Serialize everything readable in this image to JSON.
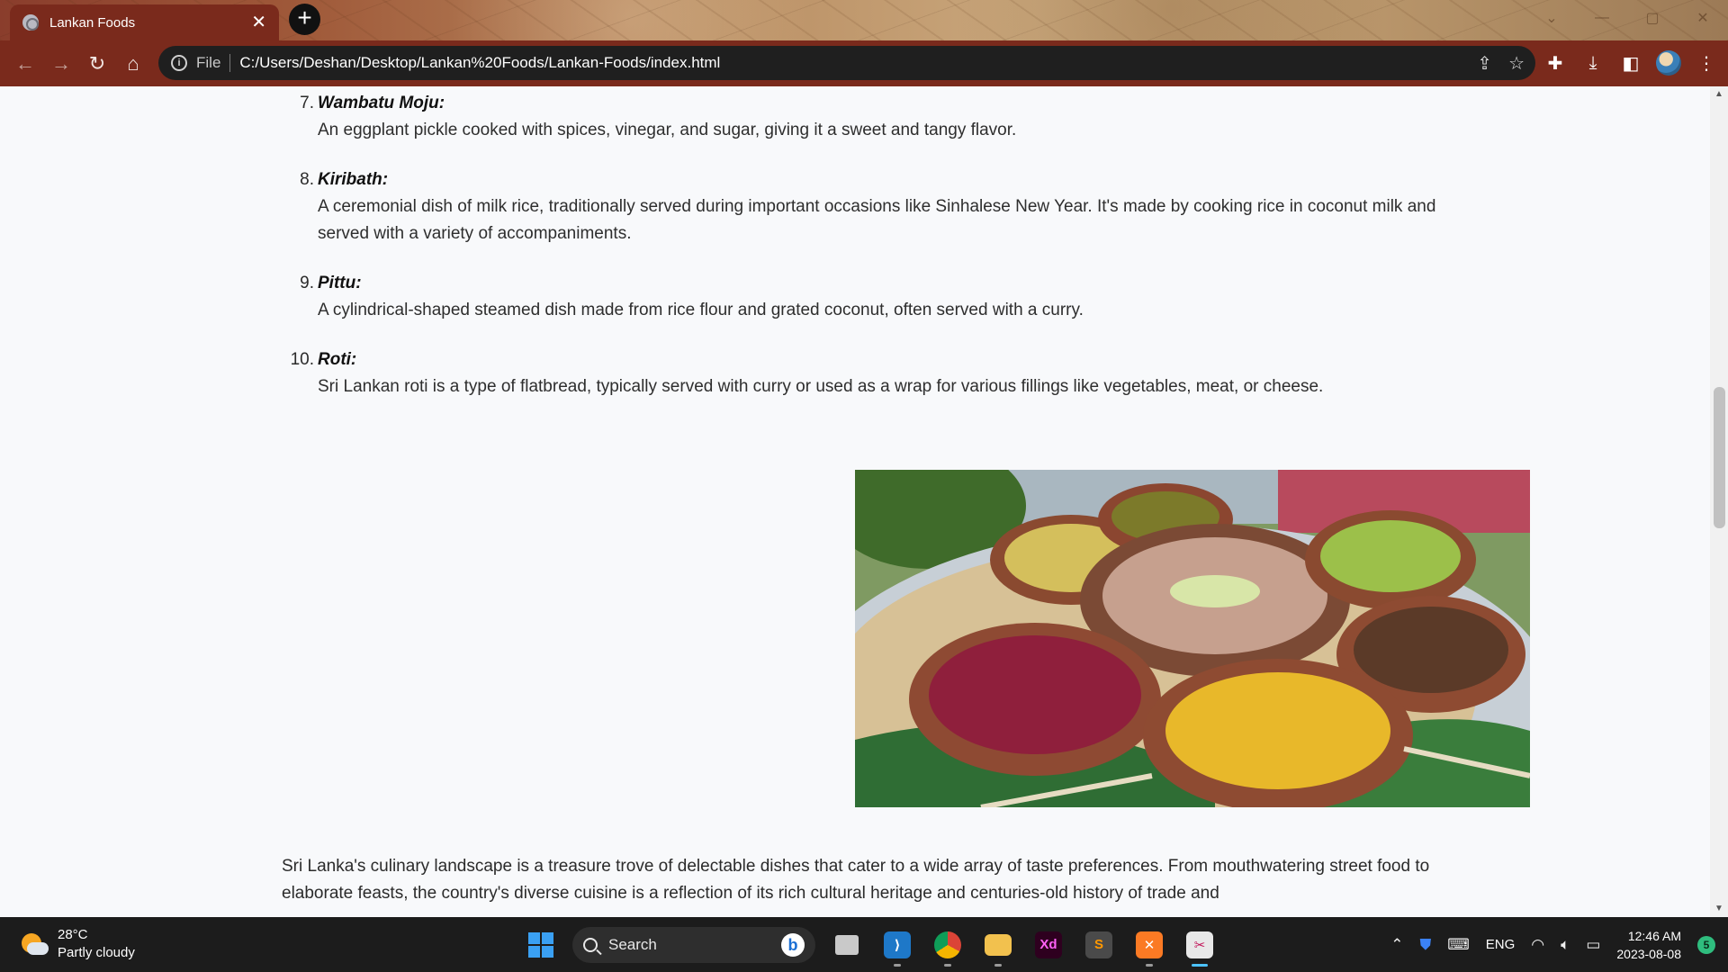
{
  "browser": {
    "tab_title": "Lankan Foods",
    "tab_close": "✕",
    "new_tab": "+",
    "address_prefix": "File",
    "address_url": "C:/Users/Deshan/Desktop/Lankan%20Foods/Lankan-Foods/index.html"
  },
  "foods": [
    {
      "num": "7.",
      "name": "Wambatu Moju:",
      "desc": "An eggplant pickle cooked with spices, vinegar, and sugar, giving it a sweet and tangy flavor."
    },
    {
      "num": "8.",
      "name": "Kiribath:",
      "desc": "A ceremonial dish of milk rice, traditionally served during important occasions like Sinhalese New Year. It's made by cooking rice in coconut milk and served with a variety of accompaniments."
    },
    {
      "num": "9.",
      "name": "Pittu:",
      "desc": "A cylindrical-shaped steamed dish made from rice flour and grated coconut, often served with a curry."
    },
    {
      "num": "10.",
      "name": "Roti:",
      "desc": "Sri Lankan roti is a type of flatbread, typically served with curry or used as a wrap for various fillings like vegetables, meat, or cheese."
    }
  ],
  "intro_paragraph": "Sri Lanka's culinary landscape is a treasure trove of delectable dishes that cater to a wide array of taste preferences. From mouthwatering street food to elaborate feasts, the country's diverse cuisine is a reflection of its rich cultural heritage and centuries-old history of trade and",
  "taskbar": {
    "weather_temp": "28°C",
    "weather_desc": "Partly cloudy",
    "search_label": "Search",
    "language": "ENG",
    "time": "12:46 AM",
    "date": "2023-08-08",
    "notification_count": "5"
  },
  "colors": {
    "chrome_toolbar": "#7a2a1c",
    "page_bg": "#f8f9fb",
    "taskbar_bg": "#1c1c1c"
  }
}
